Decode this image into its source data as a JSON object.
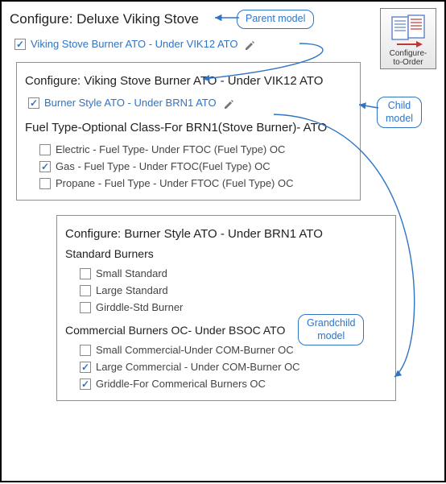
{
  "callouts": {
    "parent": "Parent model",
    "child": "Child\nmodel",
    "grandchild": "Grandchild\nmodel"
  },
  "cto_tile": {
    "label": "Configure-\nto-Order"
  },
  "top": {
    "title": "Configure: Deluxe Viking Stove",
    "option1": {
      "label": "Viking Stove Burner ATO - Under VIK12 ATO",
      "checked": true,
      "editable": true
    }
  },
  "childPanel": {
    "title": "Configure: Viking Stove Burner ATO - Under VIK12 ATO",
    "option1": {
      "label": "Burner Style ATO - Under BRN1 ATO",
      "checked": true,
      "editable": true
    },
    "group_title": "Fuel Type-Optional Class-For BRN1(Stove Burner)- ATO",
    "options": [
      {
        "label": "Electric - Fuel Type- Under FTOC (Fuel Type) OC",
        "checked": false
      },
      {
        "label": "Gas - Fuel Type - Under FTOC(Fuel Type) OC",
        "checked": true
      },
      {
        "label": "Propane - Fuel Type - Under FTOC (Fuel Type) OC",
        "checked": false
      }
    ]
  },
  "grandchildPanel": {
    "title": "Configure: Burner Style ATO - Under BRN1 ATO",
    "group1_title": "Standard Burners",
    "group1_options": [
      {
        "label": "Small Standard",
        "checked": false
      },
      {
        "label": "Large Standard",
        "checked": false
      },
      {
        "label": "Girddle-Std Burner",
        "checked": false
      }
    ],
    "group2_title": "Commercial Burners OC- Under BSOC ATO",
    "group2_options": [
      {
        "label": "Small Commercial-Under COM-Burner OC",
        "checked": false
      },
      {
        "label": "Large Commercial - Under COM-Burner OC",
        "checked": true
      },
      {
        "label": "Griddle-For Commerical Burners OC",
        "checked": true
      }
    ]
  },
  "colors": {
    "accent": "#2f74c5"
  }
}
